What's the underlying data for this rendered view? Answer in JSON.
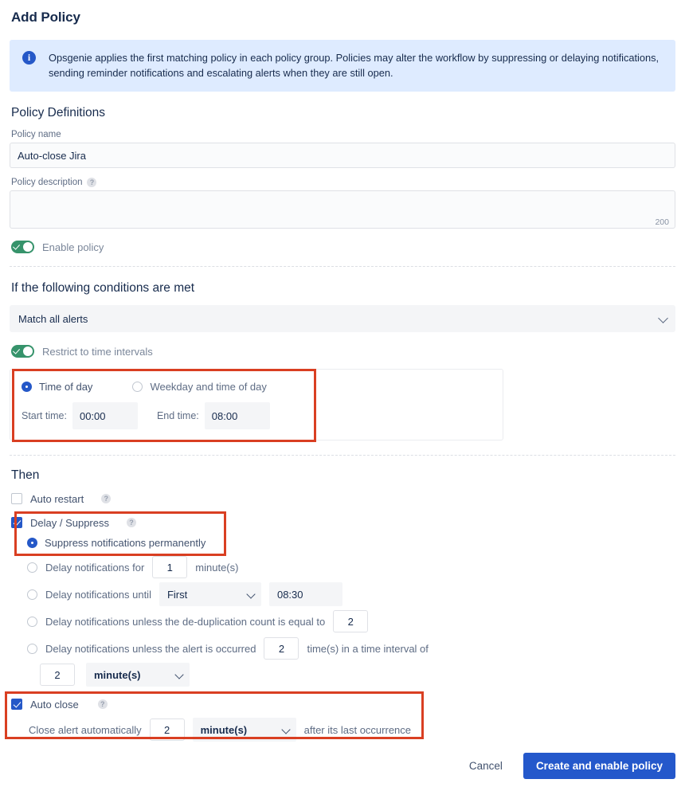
{
  "page": {
    "title": "Add Policy"
  },
  "info_banner": {
    "icon": "info-icon",
    "text": "Opsgenie applies the first matching policy in each policy group. Policies may alter the workflow by suppressing or delaying notifications, sending reminder notifications and escalating alerts when they are still open."
  },
  "policy_definitions": {
    "heading": "Policy Definitions",
    "policy_name": {
      "label": "Policy name",
      "value": "Auto-close Jira",
      "placeholder": ""
    },
    "policy_description": {
      "label": "Policy description",
      "help_icon": "question-mark-icon",
      "value": "",
      "placeholder": "",
      "char_limit": "200"
    },
    "enable_policy": {
      "label": "Enable policy",
      "state": "on"
    }
  },
  "conditions": {
    "heading": "If the following conditions are met",
    "match_select": {
      "value": "Match all alerts",
      "chevron": "chevron-down-icon"
    },
    "restrict_toggle": {
      "label": "Restrict to time intervals",
      "state": "on"
    },
    "interval": {
      "time_of_day": {
        "label": "Time of day",
        "selected": true
      },
      "weekday_time_of_day": {
        "label": "Weekday and time of day",
        "selected": false
      },
      "start_time": {
        "label": "Start time:",
        "value": "00:00"
      },
      "end_time": {
        "label": "End time:",
        "value": "08:00"
      }
    }
  },
  "then": {
    "heading": "Then",
    "auto_restart": {
      "label": "Auto restart",
      "checked": false,
      "help_icon": "question-mark-icon"
    },
    "delay_suppress": {
      "label": "Delay / Suppress",
      "checked": true,
      "help_icon": "question-mark-icon"
    },
    "options": {
      "suppress_permanently": {
        "label": "Suppress notifications permanently",
        "selected": true
      },
      "delay_for": {
        "label_before": "Delay notifications for",
        "value": "1",
        "label_after": "minute(s)",
        "selected": false
      },
      "delay_until": {
        "label_before": "Delay notifications until",
        "select_value": "First",
        "time_value": "08:30",
        "selected": false
      },
      "delay_dedup": {
        "label_before": "Delay notifications unless the de-duplication count is equal to",
        "value": "2",
        "selected": false
      },
      "delay_occurred": {
        "label_before": "Delay notifications unless the alert is occurred",
        "count_value": "2",
        "label_after": "time(s) in a time interval of",
        "interval_value": "2",
        "interval_unit": "minute(s)",
        "selected": false
      }
    },
    "auto_close": {
      "label": "Auto close",
      "checked": true,
      "help_icon": "question-mark-icon",
      "detail_before": "Close alert automatically",
      "value": "2",
      "unit": "minute(s)",
      "detail_after": "after its last occurrence"
    }
  },
  "footer": {
    "cancel_label": "Cancel",
    "submit_label": "Create and enable policy"
  },
  "colors": {
    "highlight_border": "#D93F22",
    "primary_button": "#2458CB",
    "toggle_on": "#36936B",
    "info_bg": "#DEEBFF",
    "accent_blue": "#2558C8"
  }
}
